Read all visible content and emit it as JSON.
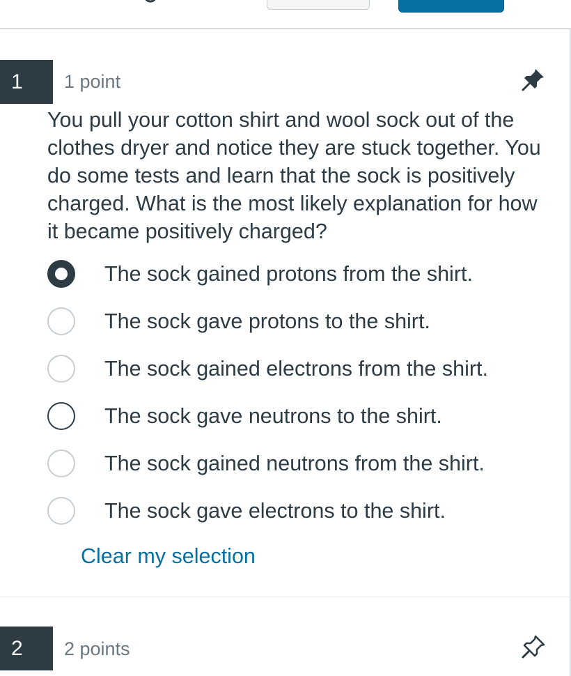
{
  "questions": [
    {
      "number": "1",
      "points": "1 point",
      "pinned": true,
      "text": "You pull your cotton shirt and wool sock out of the clothes dryer and notice they are stuck together. You do some tests and learn that the sock is positively charged. What is the most likely explanation for how it became positively charged?",
      "answers": [
        {
          "label": "The sock gained protons from the shirt.",
          "selected": true
        },
        {
          "label": "The sock gave protons to the shirt.",
          "selected": false
        },
        {
          "label": "The sock gained electrons from the shirt.",
          "selected": false
        },
        {
          "label": "The sock gave neutrons to the shirt.",
          "selected": false
        },
        {
          "label": "The sock gained neutrons from the shirt.",
          "selected": false
        },
        {
          "label": "The sock gave electrons to the shirt.",
          "selected": false
        }
      ],
      "clear_label": "Clear my selection"
    },
    {
      "number": "2",
      "points": "2 points",
      "pinned": false
    }
  ],
  "icons": {
    "top_toolbar": "tools-icon",
    "q1_flag": "pin-filled-icon",
    "q2_flag": "pin-outline-icon"
  },
  "colors": {
    "header_bg": "#2d3b45",
    "link": "#0770a3",
    "primary_button": "#0770a3",
    "muted_text": "#6b7780"
  }
}
